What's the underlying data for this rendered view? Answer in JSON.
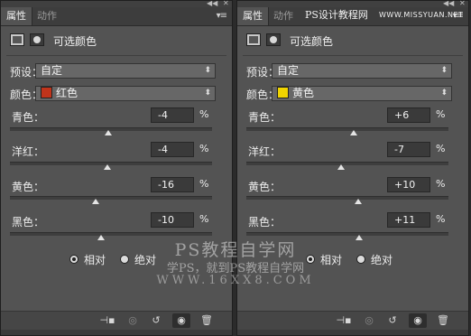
{
  "panels": [
    {
      "tabs": {
        "properties": "属性",
        "actions": "动作"
      },
      "title": "可选颜色",
      "preset": {
        "label": "预设：",
        "value": "自定"
      },
      "colors": {
        "label": "颜色：",
        "value": "红色",
        "swatch": "#c0341b"
      },
      "sliders": [
        {
          "label": "青色：",
          "value": "-4",
          "unit": "%",
          "position": 0.49
        },
        {
          "label": "洋红：",
          "value": "-4",
          "unit": "%",
          "position": 0.49
        },
        {
          "label": "黄色：",
          "value": "-16",
          "unit": "%",
          "position": 0.43
        },
        {
          "label": "黑色：",
          "value": "-10",
          "unit": "%",
          "position": 0.46
        }
      ],
      "method": {
        "relative": "相对",
        "absolute": "绝对",
        "selected": "relative"
      }
    },
    {
      "tabs": {
        "properties": "属性",
        "actions": "动作"
      },
      "title": "可选颜色",
      "preset": {
        "label": "预设：",
        "value": "自定"
      },
      "colors": {
        "label": "颜色：",
        "value": "黄色",
        "swatch": "#f0d400"
      },
      "sliders": [
        {
          "label": "青色：",
          "value": "+6",
          "unit": "%",
          "position": 0.53
        },
        {
          "label": "洋红：",
          "value": "-7",
          "unit": "%",
          "position": 0.47
        },
        {
          "label": "黄色：",
          "value": "+10",
          "unit": "%",
          "position": 0.55
        },
        {
          "label": "黑色：",
          "value": "+11",
          "unit": "%",
          "position": 0.55
        }
      ],
      "method": {
        "relative": "相对",
        "absolute": "绝对",
        "selected": "relative"
      }
    }
  ],
  "watermark": {
    "line1": "PS教程自学网",
    "line2": "学PS，就到PS教程自学网",
    "line3": "WWW.16XX8.COM",
    "site_cn": "PS设计教程网",
    "site_url": "WWW.MISSYUAN.NET"
  },
  "icons": {
    "collapse": "collapse-icon",
    "close": "close-icon",
    "panel_menu": "menu-icon",
    "clip": "clip-to-layer-icon",
    "view_previous": "view-previous-icon",
    "reset": "reset-icon",
    "visibility": "eye-icon",
    "delete": "trash-icon"
  }
}
